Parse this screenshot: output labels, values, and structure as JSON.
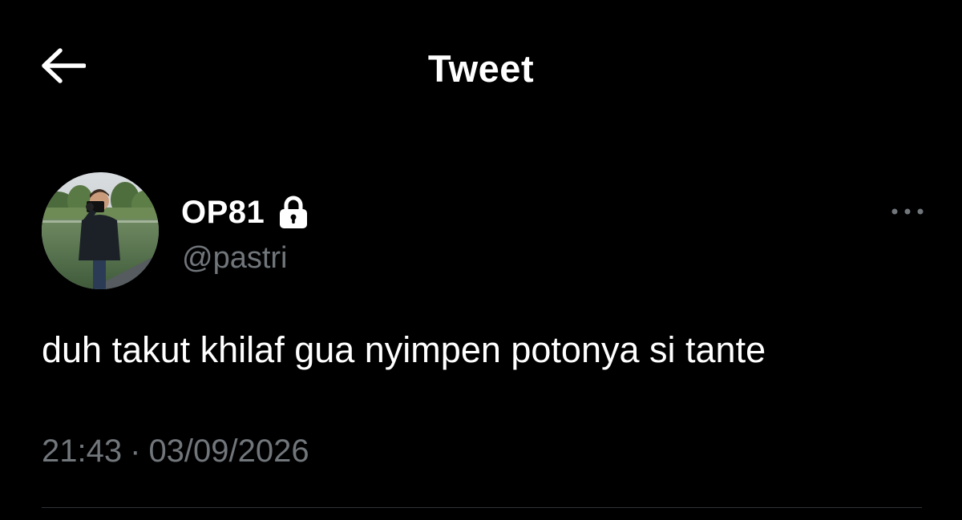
{
  "header": {
    "back_icon": "arrow-left-icon",
    "title": "Tweet"
  },
  "author": {
    "display_name": "OP81",
    "protected_icon": "lock-icon",
    "handle": "@pastri",
    "avatar": "profile-photo",
    "more_icon": "more-horizontal-icon"
  },
  "tweet": {
    "text": "duh takut khilaf gua nyimpen potonya si tante",
    "time": "21:43",
    "separator": "·",
    "date": "03/09/2026"
  },
  "colors": {
    "background": "#000000",
    "primary_text": "#ffffff",
    "secondary_text": "#71767b",
    "divider": "#2f3336"
  }
}
